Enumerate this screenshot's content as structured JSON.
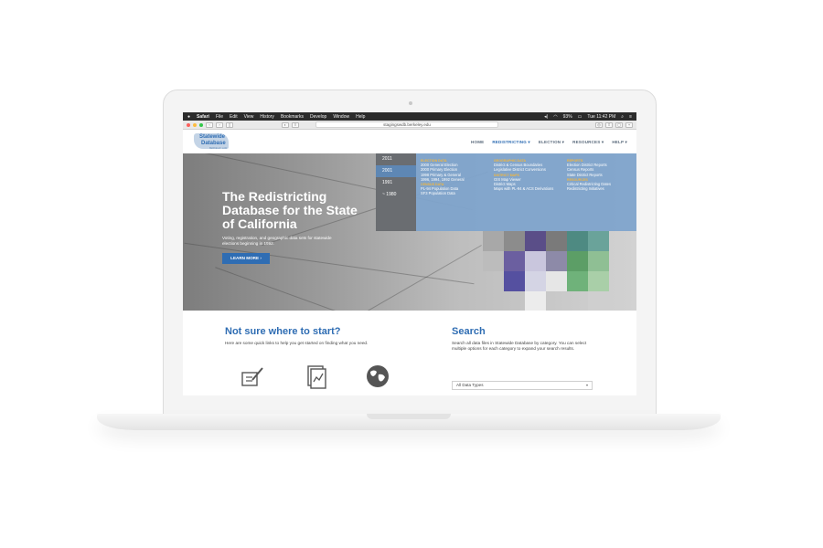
{
  "menubar": {
    "apple": "",
    "app": "Safari",
    "items": [
      "File",
      "Edit",
      "View",
      "History",
      "Bookmarks",
      "Develop",
      "Window",
      "Help"
    ],
    "battery": "93%",
    "clock": "Tue 11:42 PM"
  },
  "browser": {
    "url": "stagingswdb.berkeley.edu"
  },
  "site": {
    "logo_line1": "Statewide",
    "logo_line2": "Database",
    "logo_tagline": "BERKELEY LAW",
    "nav": [
      "HOME",
      "REDISTRICTING ▾",
      "ELECTION ▾",
      "RESOURCES ▾",
      "HELP ▾"
    ]
  },
  "hero": {
    "title": "The Redistricting Database for the State of California",
    "subtitle": "Voting, registration, and geographic data sets for statewide elections beginning in 1992.",
    "button": "LEARN MORE ›"
  },
  "years": [
    "2011",
    "2001",
    "1991",
    "~ 1980"
  ],
  "menu": {
    "col1": {
      "head1": "ELECTION DATA",
      "items1": [
        "2000 General Election",
        "2000 Primary Election",
        "1998 Primary & General",
        "1996, 1994, 1992 General"
      ],
      "head2": "CENSUS DATA",
      "items2": [
        "PL-94 Population Data",
        "SF3 Population Data"
      ]
    },
    "col2": {
      "head1": "GEOGRAPHIC DATA",
      "items1": [
        "District & Census Boundaries",
        "Legislative District Conversions"
      ],
      "head2": "DISTRICT MAPS",
      "items2": [
        "GIS Map Viewer",
        "District Maps",
        "Maps with PL-94 & ACS Derivations"
      ]
    },
    "col3": {
      "head1": "REPORTS",
      "items1": [
        "Election District Reports",
        "Census Reports",
        "State District Reports"
      ],
      "head2": "RESOURCES",
      "items2": [
        "Critical Redistricting Dates",
        "Redistricting Initiatives"
      ]
    }
  },
  "start": {
    "title": "Not sure where to start?",
    "text": "Here are some quick links to help you get started on finding what you need."
  },
  "search": {
    "title": "Search",
    "text": "Search all data files in Statewide Database by category. You can select multiple options for each category to expand your search results.",
    "select_value": "All Data Types"
  },
  "colors": {
    "brand": "#2f6db3",
    "menu_bg": "#7ea4cc",
    "menu_heading": "#f4b63b"
  }
}
